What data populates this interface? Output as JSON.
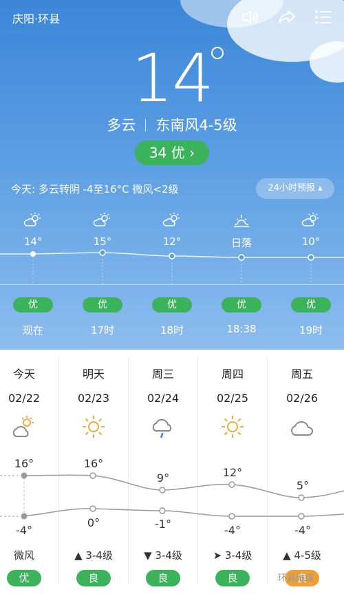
{
  "header": {
    "location": "庆阳·环县"
  },
  "current": {
    "temperature": "14",
    "condition": "多云",
    "wind": "东南风4-5级",
    "aqi_label": "34 优 ›"
  },
  "today_summary": "今天: 多云转阴 -4至16°C 微风<2级",
  "forecast_24h_button": "24小时预报 ▴",
  "hourly": [
    {
      "temp": "14°",
      "quality": "优",
      "time": "现在",
      "icon": "partly-cloudy-icon"
    },
    {
      "temp": "15°",
      "quality": "优",
      "time": "17时",
      "icon": "partly-cloudy-icon"
    },
    {
      "temp": "12°",
      "quality": "优",
      "time": "18时",
      "icon": "partly-cloudy-icon"
    },
    {
      "temp": "日落",
      "quality": "优",
      "time": "18:38",
      "icon": "sunset-icon"
    },
    {
      "temp": "10°",
      "quality": "优",
      "time": "19时",
      "icon": "partly-cloudy-icon"
    }
  ],
  "daily": [
    {
      "day": "今天",
      "date": "02/22",
      "icon": "partly-cloudy-icon",
      "high": "16°",
      "low": "-4°",
      "wind": "微风",
      "quality": "优",
      "quality_color": "#3bb35a"
    },
    {
      "day": "明天",
      "date": "02/23",
      "icon": "sunny-icon",
      "high": "16°",
      "low": "0°",
      "wind": "▲ 3-4级",
      "quality": "良",
      "quality_color": "#3bb35a"
    },
    {
      "day": "周三",
      "date": "02/24",
      "icon": "light-rain-icon",
      "high": "9°",
      "low": "-1°",
      "wind": "▼ 3-4级",
      "quality": "良",
      "quality_color": "#3bb35a"
    },
    {
      "day": "周四",
      "date": "02/25",
      "icon": "sunny-icon",
      "high": "12°",
      "low": "-4°",
      "wind": "➤ 3-4级",
      "quality": "良",
      "quality_color": "#3bb35a"
    },
    {
      "day": "周五",
      "date": "02/26",
      "icon": "cloudy-icon",
      "high": "5°",
      "low": "-4°",
      "wind": "▲ 4-5级",
      "quality": "良",
      "quality_color": "#f0a030"
    }
  ],
  "watermark": "环县融媒",
  "colors": {
    "accent_green": "#3bb35a",
    "sky_top": "#3b86d8",
    "sky_bottom": "#8dbdee"
  }
}
